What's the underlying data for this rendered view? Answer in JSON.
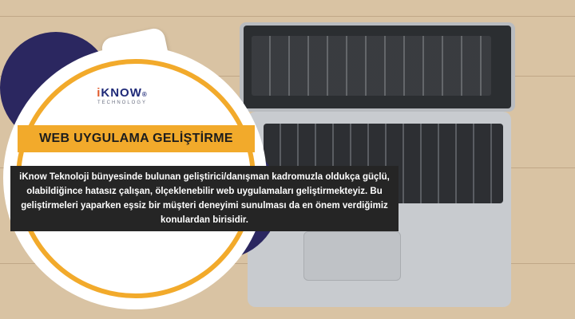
{
  "brand": {
    "logo_main_prefix": "i",
    "logo_main": "KNOW",
    "logo_mark": "®",
    "logo_sub": "TECHNOLOGY",
    "colors": {
      "navy": "#1f2a78",
      "orange": "#f2aa2b",
      "purple": "#2b2760",
      "dark_box": "#252525"
    }
  },
  "heading": {
    "title": "WEB UYGULAMA GELİŞTİRME"
  },
  "description": {
    "text": "iKnow Teknoloji bünyesinde bulunan geliştirici/danışman kadromuzla oldukça güçlü, olabildiğince hatasız çalışan, ölçeklenebilir web uygulamaları geliştirmekteyiz. Bu geliştirmeleri yaparken eşsiz bir müşteri deneyimi sunulması da en önem verdiğimiz konulardan birisidir."
  }
}
